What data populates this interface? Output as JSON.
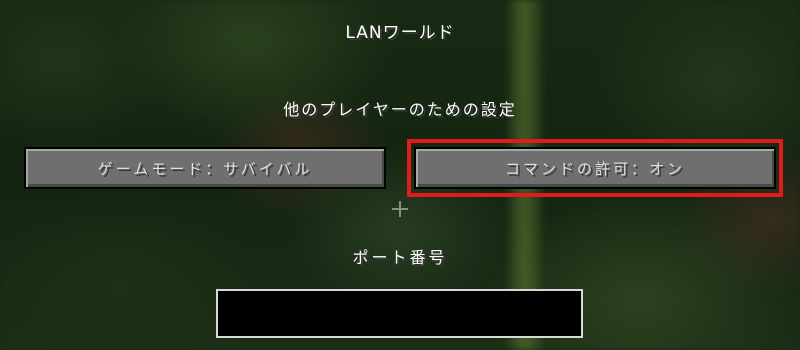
{
  "screen": {
    "title": "LANワールド",
    "section_label": "他のプレイヤーのための設定"
  },
  "buttons": {
    "game_mode": "ゲームモード：サバイバル",
    "allow_commands": "コマンドの許可：オン"
  },
  "port": {
    "label": "ポート番号",
    "value": "",
    "placeholder": ""
  },
  "colors": {
    "highlight": "#e01b1b",
    "button_face": "#6f6f6f"
  }
}
